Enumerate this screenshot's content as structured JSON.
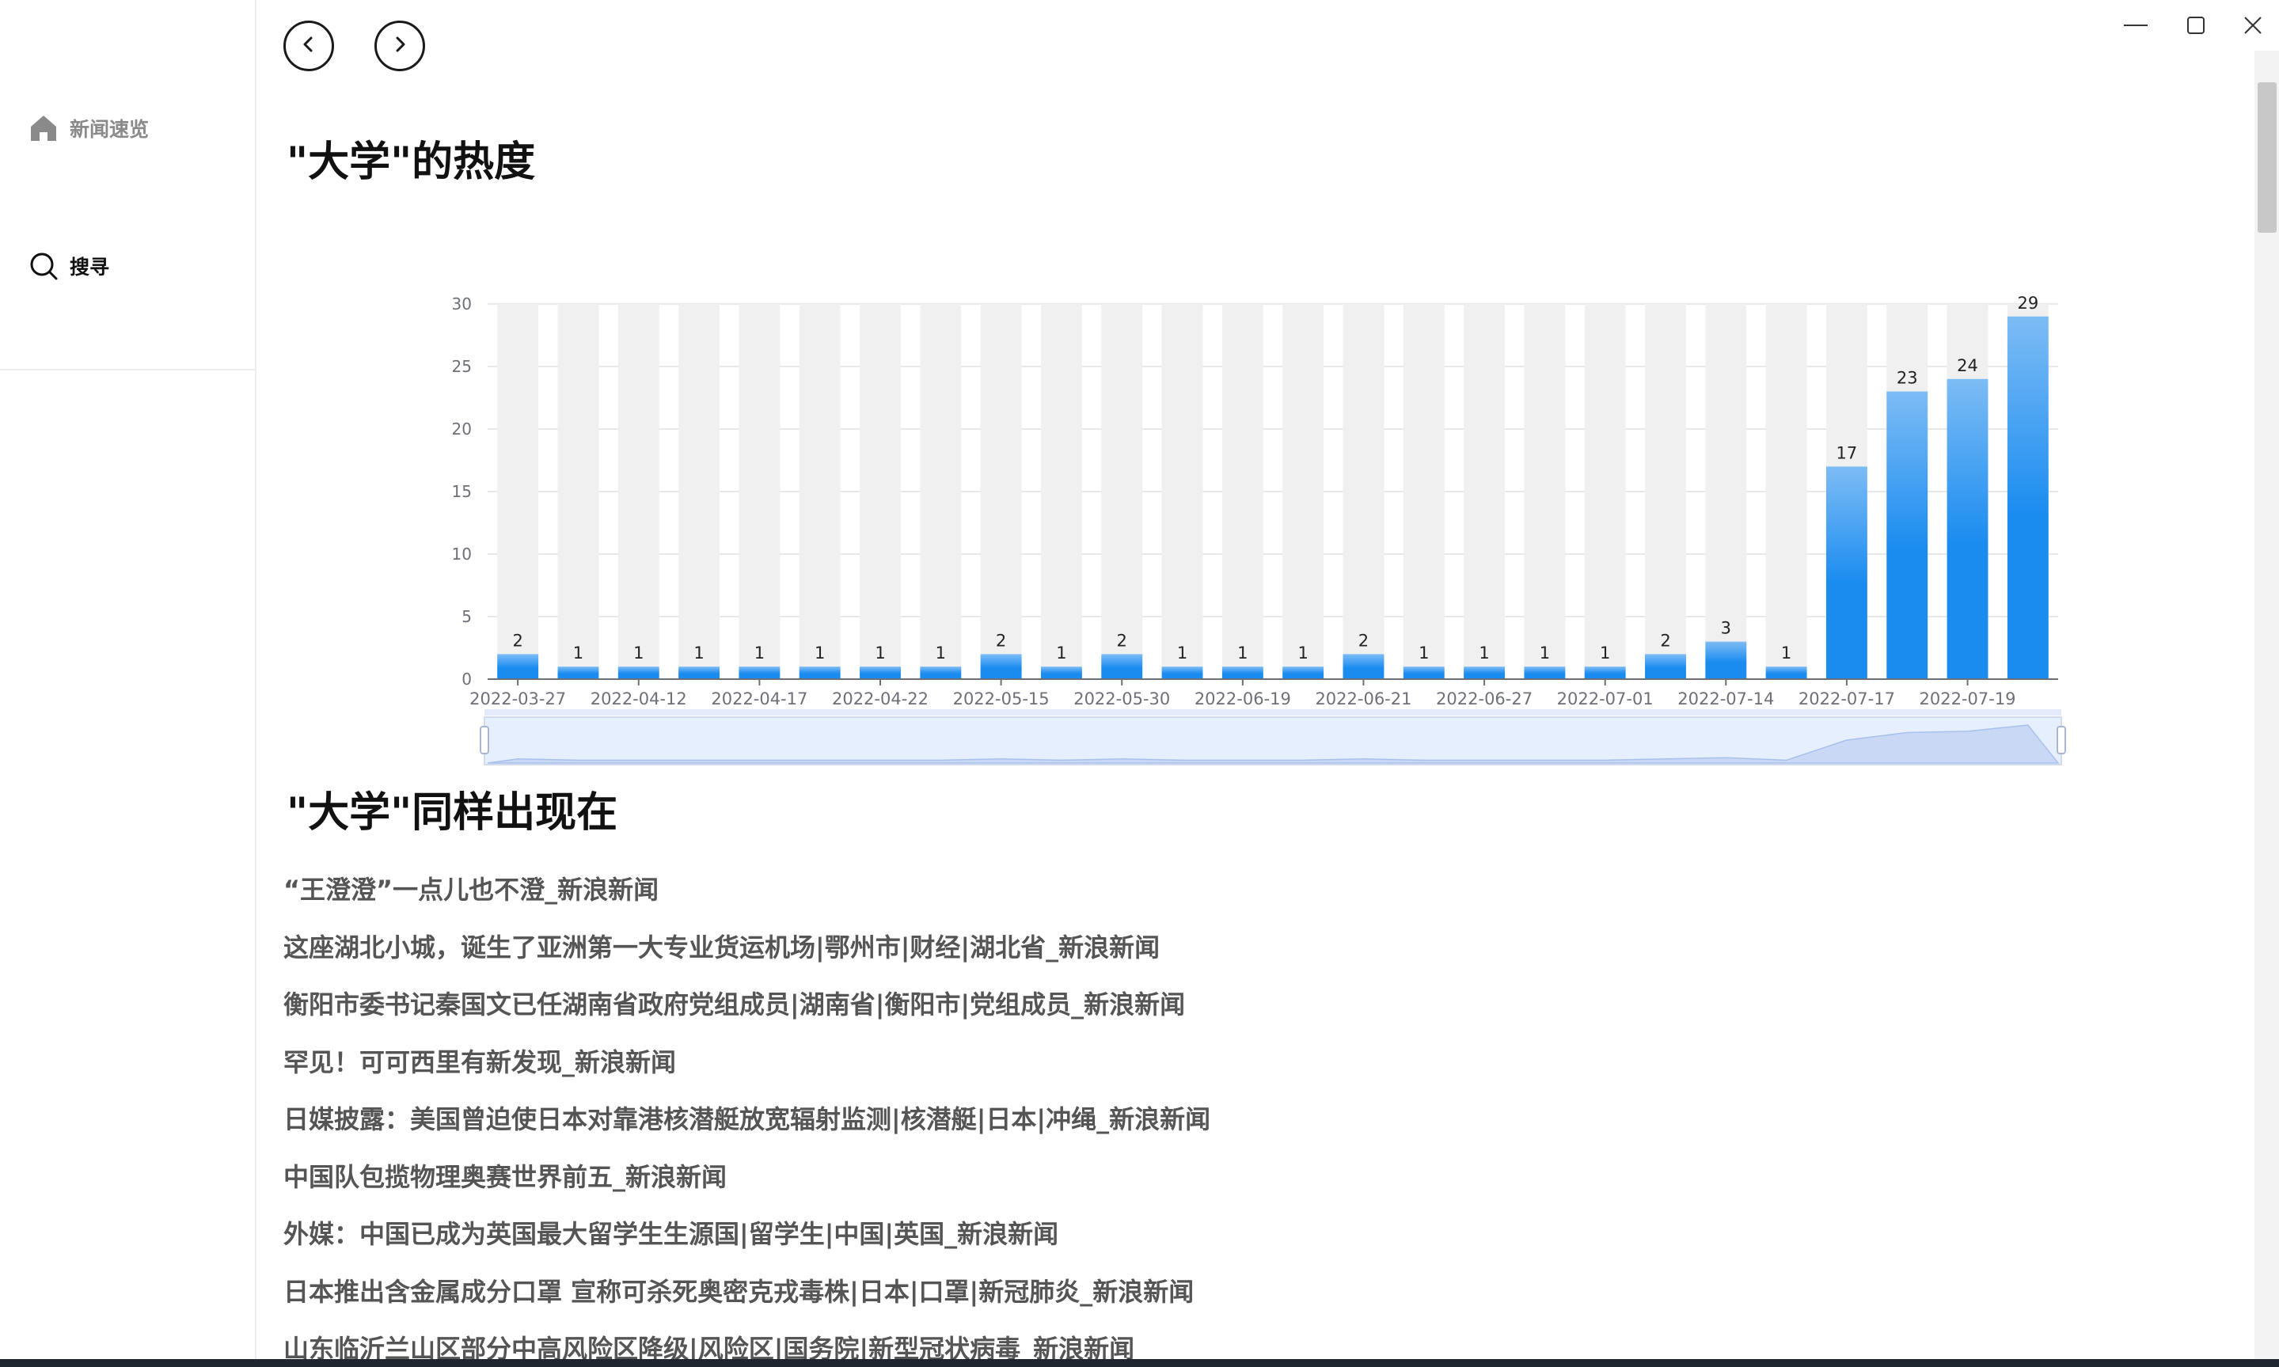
{
  "sidebar": {
    "items": [
      {
        "label": "新闻速览",
        "icon": "home-icon"
      },
      {
        "label": "搜寻",
        "icon": "search-icon"
      }
    ]
  },
  "toolbar": {
    "back_icon": "chevron-left-icon",
    "forward_icon": "chevron-right-icon"
  },
  "window_controls": {
    "minimize": "minimize-icon",
    "maximize": "maximize-icon",
    "close": "close-icon"
  },
  "main": {
    "hot_title": "\"大学\"的热度",
    "also_title": "\"大学\"同样出现在",
    "news": [
      "“王澄澄”一点儿也不澄_新浪新闻",
      "这座湖北小城，诞生了亚洲第一大专业货运机场|鄂州市|财经|湖北省_新浪新闻",
      "衡阳市委书记秦国文已任湖南省政府党组成员|湖南省|衡阳市|党组成员_新浪新闻",
      "罕见！可可西里有新发现_新浪新闻",
      "日媒披露：美国曾迫使日本对靠港核潜艇放宽辐射监测|核潜艇|日本|冲绳_新浪新闻",
      "中国队包揽物理奥赛世界前五_新浪新闻",
      "外媒：中国已成为英国最大留学生生源国|留学生|中国|英国_新浪新闻",
      "日本推出含金属成分口罩 宣称可杀死奥密克戎毒株|日本|口罩|新冠肺炎_新浪新闻",
      "山东临沂兰山区部分中高风险区降级|风险区|国务院|新型冠状病毒_新浪新闻"
    ]
  },
  "chart_data": {
    "type": "bar",
    "title": "",
    "xlabel": "",
    "ylabel": "",
    "ylim": [
      0,
      30
    ],
    "yticks": [
      0,
      5,
      10,
      15,
      20,
      25,
      30
    ],
    "grid": true,
    "background_bars": true,
    "data_labels": true,
    "dataZoom_slider": true,
    "bar_color_top": "#7dbcf5",
    "bar_color_bottom": "#1a8cf0",
    "background_color": "#f0f0f0",
    "visible_tick_labels": [
      "2022-03-27",
      "2022-04-12",
      "2022-04-17",
      "2022-04-22",
      "2022-05-15",
      "2022-05-30",
      "2022-06-19",
      "2022-06-21",
      "2022-06-27",
      "2022-07-01",
      "2022-07-14",
      "2022-07-17",
      "2022-07-19"
    ],
    "values": [
      2,
      1,
      1,
      1,
      1,
      1,
      1,
      1,
      2,
      1,
      2,
      1,
      1,
      1,
      2,
      1,
      1,
      1,
      1,
      2,
      3,
      1,
      17,
      23,
      24,
      29
    ]
  }
}
